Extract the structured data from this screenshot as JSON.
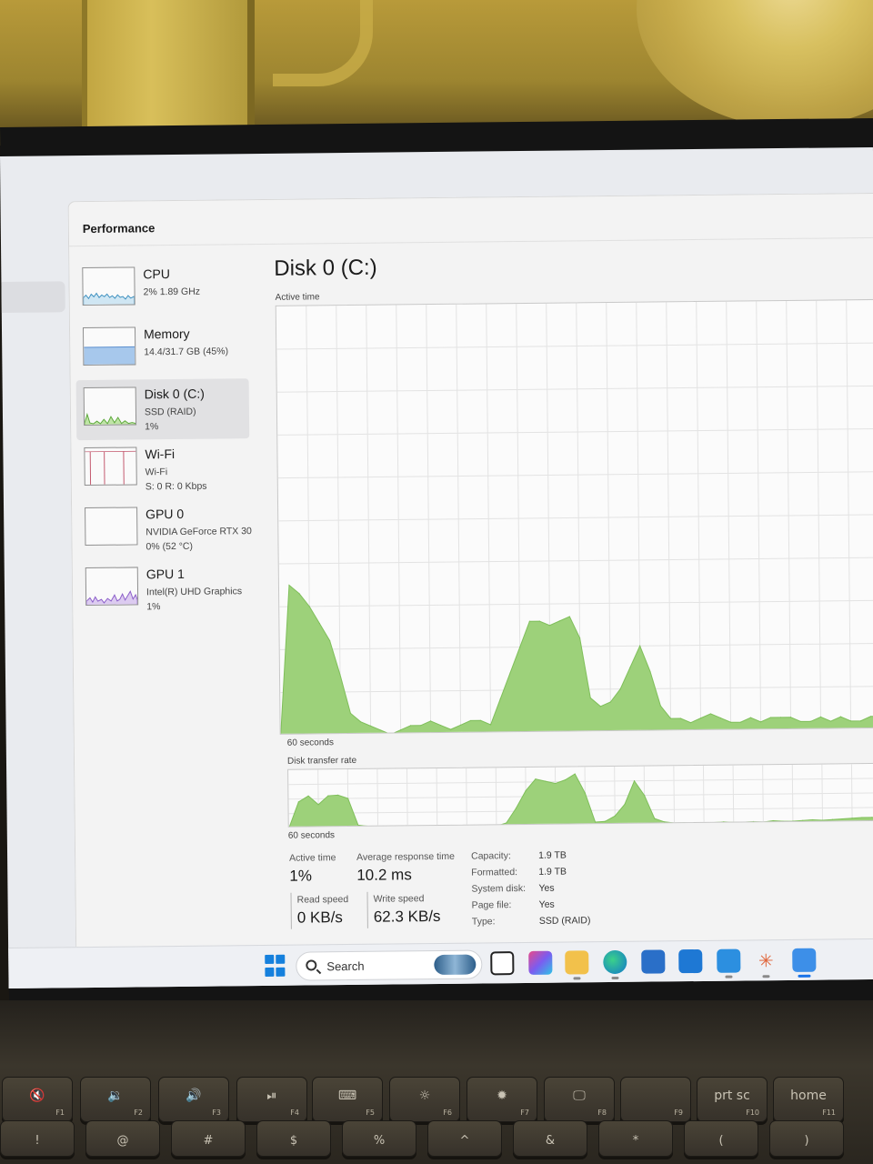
{
  "window": {
    "page_title": "Performance"
  },
  "sidebar": {
    "items": [
      {
        "name": "CPU",
        "line1": "2%  1.89 GHz",
        "line2": ""
      },
      {
        "name": "Memory",
        "line1": "14.4/31.7 GB (45%)",
        "line2": ""
      },
      {
        "name": "Disk 0 (C:)",
        "line1": "SSD (RAID)",
        "line2": "1%"
      },
      {
        "name": "Wi-Fi",
        "line1": "Wi-Fi",
        "line2": "S: 0  R: 0 Kbps"
      },
      {
        "name": "GPU 0",
        "line1": "NVIDIA GeForce RTX 30",
        "line2": "0%  (52 °C)"
      },
      {
        "name": "GPU 1",
        "line1": "Intel(R) UHD Graphics",
        "line2": "1%"
      }
    ]
  },
  "main": {
    "title": "Disk 0 (C:)",
    "graph1_label": "Active time",
    "graph1_time": "60 seconds",
    "graph2_label": "Disk transfer rate",
    "graph2_time": "60 seconds",
    "accent_color": "#9dd17a",
    "stats": {
      "active_time_label": "Active time",
      "active_time_value": "1%",
      "avg_response_label": "Average response time",
      "avg_response_value": "10.2 ms",
      "read_speed_label": "Read speed",
      "read_speed_value": "0 KB/s",
      "write_speed_label": "Write speed",
      "write_speed_value": "62.3 KB/s"
    },
    "properties": [
      {
        "key": "Capacity:",
        "value": "1.9 TB"
      },
      {
        "key": "Formatted:",
        "value": "1.9 TB"
      },
      {
        "key": "System disk:",
        "value": "Yes"
      },
      {
        "key": "Page file:",
        "value": "Yes"
      },
      {
        "key": "Type:",
        "value": "SSD (RAID)"
      }
    ]
  },
  "chart_data": [
    {
      "type": "area",
      "title": "Active time",
      "xlabel": "60 seconds",
      "x": [
        0,
        1,
        2,
        3,
        4,
        5,
        6,
        7,
        8,
        9,
        10,
        11,
        12,
        13,
        14,
        15,
        16,
        17,
        18,
        19,
        20,
        21,
        22,
        23,
        24,
        25,
        26,
        27,
        28,
        29,
        30,
        31,
        32,
        33,
        34,
        35,
        36,
        37,
        38,
        39,
        40,
        41,
        42,
        43,
        44,
        45,
        46,
        47,
        48,
        49,
        50,
        51,
        52,
        53,
        54,
        55,
        56,
        57,
        58,
        59,
        60
      ],
      "series": [
        {
          "values": [
            0,
            35,
            33,
            30,
            26,
            22,
            14,
            5,
            3,
            2,
            1,
            0,
            1,
            2,
            2,
            3,
            2,
            1,
            2,
            3,
            3,
            2,
            8,
            14,
            20,
            26,
            26,
            25,
            26,
            27,
            22,
            8,
            6,
            7,
            10,
            15,
            20,
            14,
            6,
            3,
            3,
            2,
            3,
            4,
            3,
            2,
            2,
            3,
            2,
            3,
            3,
            3,
            2,
            2,
            3,
            2,
            3,
            2,
            2,
            3,
            3
          ]
        }
      ],
      "ylim": [
        0,
        100
      ]
    },
    {
      "type": "area",
      "title": "Disk transfer rate",
      "xlabel": "60 seconds",
      "x": [
        0,
        1,
        2,
        3,
        4,
        5,
        6,
        7,
        8,
        9,
        10,
        11,
        12,
        13,
        14,
        15,
        16,
        17,
        18,
        19,
        20,
        21,
        22,
        23,
        24,
        25,
        26,
        27,
        28,
        29,
        30,
        31,
        32,
        33,
        34,
        35,
        36,
        37,
        38,
        39,
        40,
        41,
        42,
        43,
        44,
        45,
        46,
        47,
        48,
        49,
        50,
        51,
        52,
        53,
        54,
        55,
        56,
        57,
        58,
        59,
        60
      ],
      "series": [
        {
          "values": [
            0,
            45,
            55,
            40,
            55,
            56,
            50,
            4,
            2,
            1,
            0,
            0,
            0,
            0,
            0,
            0,
            0,
            0,
            0,
            0,
            0,
            0,
            5,
            30,
            60,
            80,
            76,
            72,
            78,
            88,
            55,
            5,
            6,
            15,
            35,
            75,
            50,
            10,
            4,
            2,
            2,
            1,
            2,
            2,
            3,
            2,
            2,
            3,
            2,
            4,
            3,
            3,
            4,
            5,
            4,
            5,
            6,
            7,
            8,
            8,
            8
          ]
        }
      ],
      "ylim": [
        0,
        100
      ]
    }
  ],
  "taskbar": {
    "search_label": "Search",
    "icons": [
      "windows-start-icon",
      "search-icon",
      "task-view-icon",
      "copilot-m365-icon",
      "file-explorer-icon",
      "edge-icon",
      "microsoft-store-icon",
      "outlook-icon",
      "teams-icon",
      "claude-icon",
      "task-manager-icon"
    ]
  },
  "keyboard": {
    "fn_keys": [
      {
        "glyph": "🔇",
        "fn": "F1"
      },
      {
        "glyph": "🔉",
        "fn": "F2"
      },
      {
        "glyph": "🔊",
        "fn": "F3"
      },
      {
        "glyph": "⏯",
        "fn": "F4"
      },
      {
        "glyph": "⌨",
        "fn": "F5"
      },
      {
        "glyph": "☼",
        "fn": "F6"
      },
      {
        "glyph": "✹",
        "fn": "F7"
      },
      {
        "glyph": "🖵",
        "fn": "F8"
      },
      {
        "glyph": "",
        "fn": "F9"
      },
      {
        "glyph": "prt sc",
        "fn": "F10"
      },
      {
        "glyph": "home",
        "fn": "F11"
      }
    ],
    "number_row": [
      "!",
      "@",
      "#",
      "$",
      "%",
      "^",
      "&",
      "*",
      "(",
      ")"
    ]
  }
}
